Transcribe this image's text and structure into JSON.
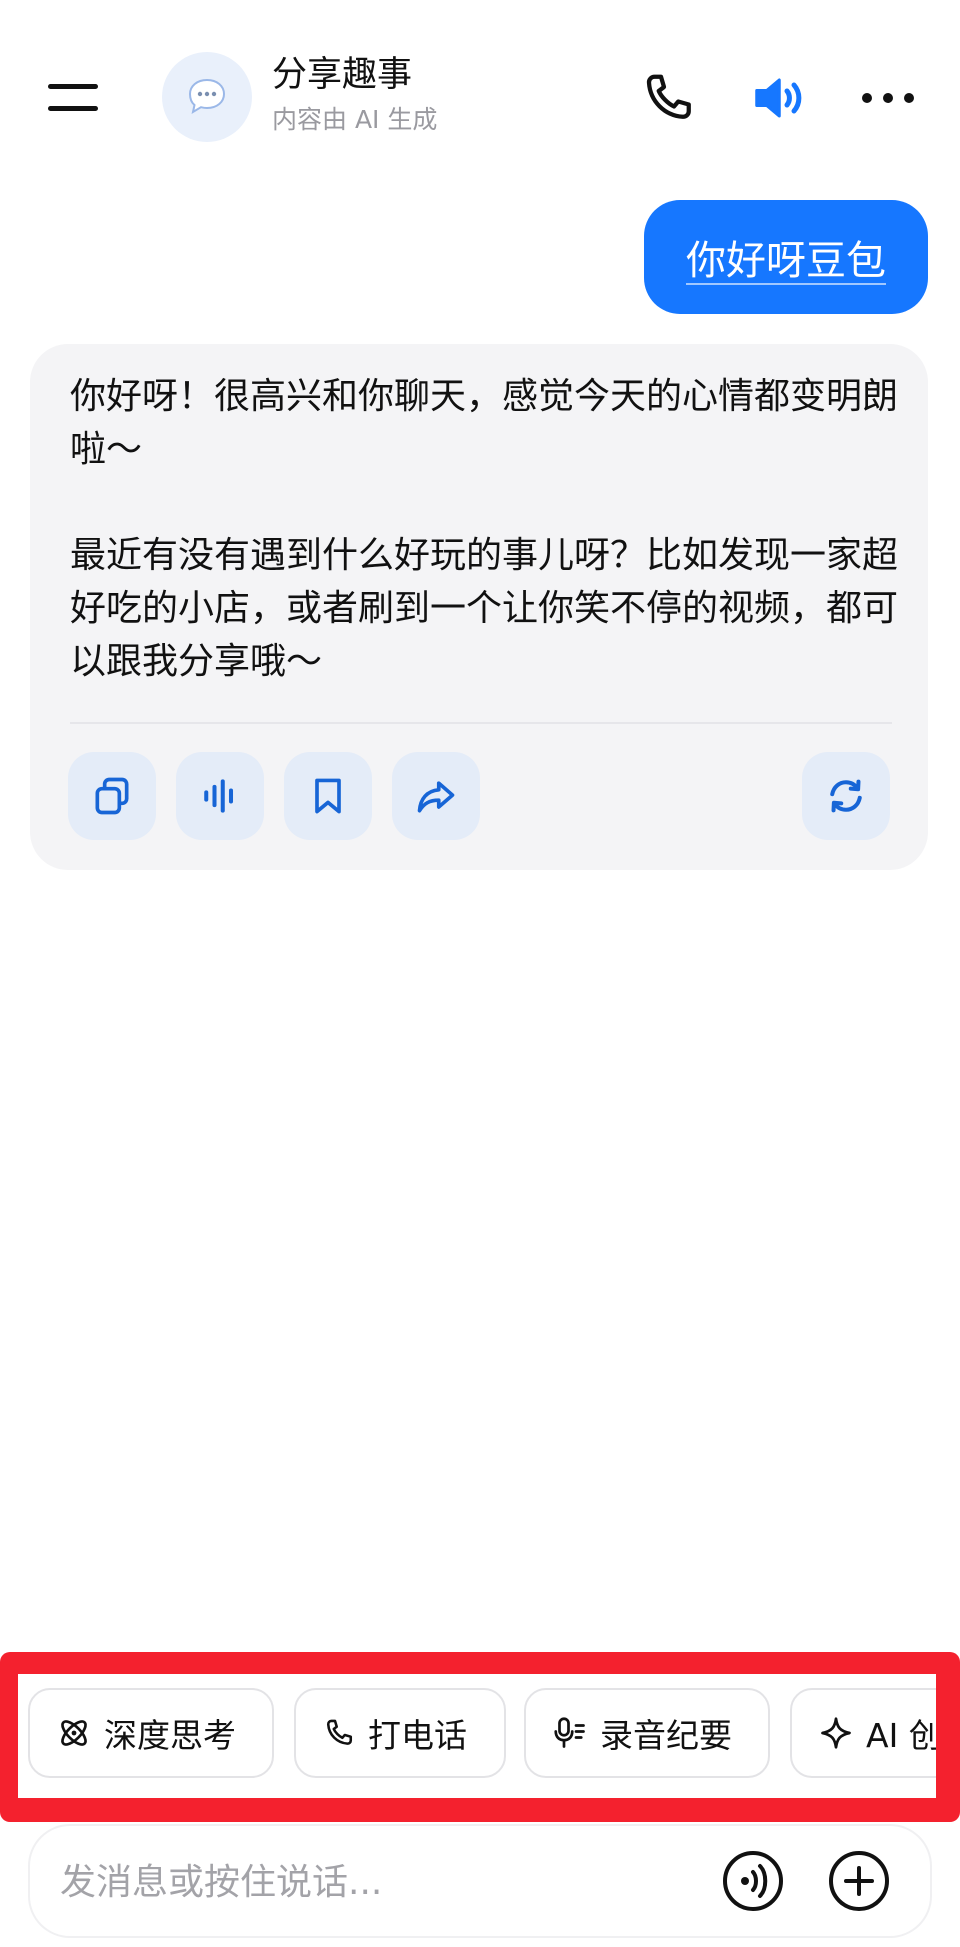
{
  "header": {
    "title": "分享趣事",
    "subtitle": "内容由 AI 生成",
    "menu_icon": "menu-icon",
    "avatar_icon": "chat-bubble-icon",
    "actions": [
      "phone-icon",
      "speaker-icon",
      "more-icon"
    ]
  },
  "conversation": {
    "user_message": "你好呀豆包",
    "ai_message": {
      "paragraph1": "你好呀！很高兴和你聊天，感觉今天的心情都变明朗啦～",
      "paragraph2": "最近有没有遇到什么好玩的事儿呀？比如发现一家超好吃的小店，或者刷到一个让你笑不停的视频，都可以跟我分享哦～"
    },
    "actions": [
      "copy-icon",
      "voice-wave-icon",
      "bookmark-icon",
      "share-icon",
      "regenerate-icon"
    ]
  },
  "quick_actions": [
    {
      "label": "深度思考",
      "icon": "atom-icon"
    },
    {
      "label": "打电话",
      "icon": "phone-icon"
    },
    {
      "label": "录音纪要",
      "icon": "mic-icon"
    },
    {
      "label": "AI 创",
      "icon": "sparkle-icon"
    }
  ],
  "input": {
    "placeholder": "发消息或按住说话...",
    "icons": [
      "voice-mode-icon",
      "plus-icon"
    ]
  },
  "colors": {
    "accent": "#1677ff",
    "highlight_frame": "#f4212e",
    "card_bg": "#f4f4f6",
    "action_btn_bg": "#e4ecf8"
  }
}
